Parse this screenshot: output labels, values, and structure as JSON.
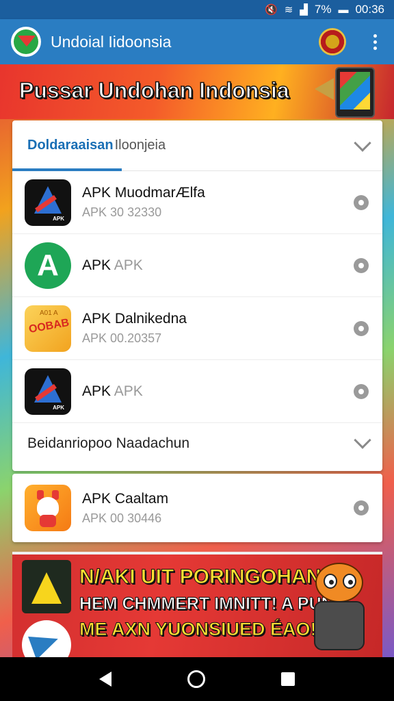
{
  "status_bar": {
    "battery": "7%",
    "time": "00:36",
    "icons": [
      "mute-icon",
      "wifi-icon",
      "signal-icon",
      "battery-icon"
    ]
  },
  "app_bar": {
    "title": "Undoial Iidoonsia",
    "logo_icon": "app-logo-icon",
    "emblem_icon": "garuda-emblem-icon",
    "menu_icon": "overflow-menu-icon"
  },
  "banner": {
    "title": "Pussar Undohan Indonsia"
  },
  "section1": {
    "tab_active": "Doldaraaisan",
    "tab_rest": "Iloonjeia",
    "items": [
      {
        "name_prefix": "APK",
        "name": "MuodmarÆlfa",
        "sub_prefix": "APK",
        "sub": "30 32330",
        "icon": "apk-a-dark-icon"
      },
      {
        "name_prefix": "APK",
        "name": "APK",
        "sub_prefix": "",
        "sub": "",
        "icon": "apk-green-circle-icon"
      },
      {
        "name_prefix": "APK",
        "name": "Dalnikedna",
        "sub_prefix": "APK",
        "sub": "00.20357",
        "icon": "apk-yellow-label-icon"
      },
      {
        "name_prefix": "APK",
        "name": "APK",
        "sub_prefix": "",
        "sub": "",
        "icon": "apk-a-dark-icon"
      }
    ]
  },
  "section2": {
    "header": "Beidanriopoo Naadachun",
    "items": [
      {
        "name_prefix": "APK",
        "name": "Caaltam",
        "sub_prefix": "APK",
        "sub": "00 30446",
        "icon": "apk-mascot-icon"
      }
    ]
  },
  "promo": {
    "line1": "N/AKI UIT PORINGOHAN",
    "line2": "HEM CHMMERT IMNITT! A PUNI",
    "line3": "ME AXN YUONSIUED ÉAO!!"
  },
  "colors": {
    "primary": "#2a7dc2",
    "status_bar": "#1b5e9e",
    "banner_red": "#e8352d",
    "promo_yellow": "#ffe033"
  }
}
